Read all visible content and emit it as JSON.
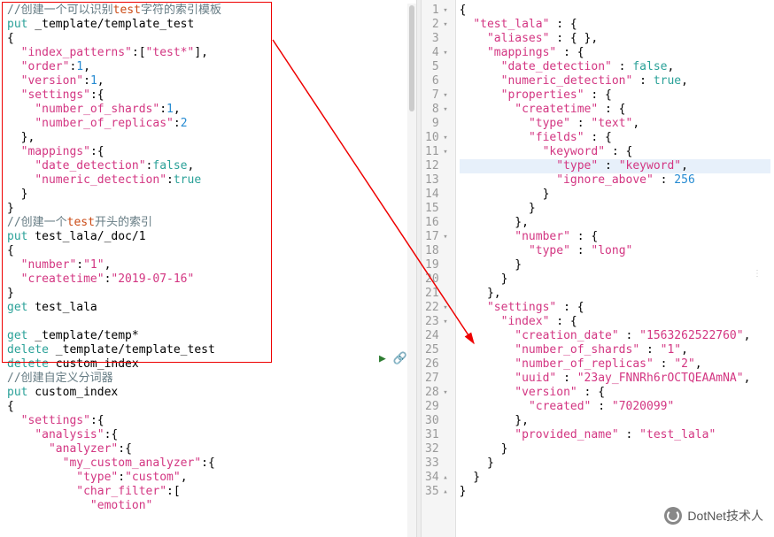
{
  "left": {
    "lines": [
      {
        "segs": [
          {
            "t": "//创建一个可以识别",
            "c": "cmt"
          },
          {
            "t": "test",
            "c": "red"
          },
          {
            "t": "字符的索引模板",
            "c": "cmt"
          }
        ]
      },
      {
        "segs": [
          {
            "t": "put",
            "c": "kw"
          },
          {
            "t": " _template/template_test"
          }
        ]
      },
      {
        "segs": [
          {
            "t": "{"
          }
        ]
      },
      {
        "segs": [
          {
            "t": "  "
          },
          {
            "t": "\"index_patterns\"",
            "c": "str"
          },
          {
            "t": ":["
          },
          {
            "t": "\"test*\"",
            "c": "str"
          },
          {
            "t": "],"
          }
        ]
      },
      {
        "segs": [
          {
            "t": "  "
          },
          {
            "t": "\"order\"",
            "c": "str"
          },
          {
            "t": ":"
          },
          {
            "t": "1",
            "c": "num"
          },
          {
            "t": ","
          }
        ]
      },
      {
        "segs": [
          {
            "t": "  "
          },
          {
            "t": "\"version\"",
            "c": "str"
          },
          {
            "t": ":"
          },
          {
            "t": "1",
            "c": "num"
          },
          {
            "t": ","
          }
        ]
      },
      {
        "segs": [
          {
            "t": "  "
          },
          {
            "t": "\"settings\"",
            "c": "str"
          },
          {
            "t": ":{"
          }
        ]
      },
      {
        "segs": [
          {
            "t": "    "
          },
          {
            "t": "\"number_of_shards\"",
            "c": "str"
          },
          {
            "t": ":"
          },
          {
            "t": "1",
            "c": "num"
          },
          {
            "t": ","
          }
        ]
      },
      {
        "segs": [
          {
            "t": "    "
          },
          {
            "t": "\"number_of_replicas\"",
            "c": "str"
          },
          {
            "t": ":"
          },
          {
            "t": "2",
            "c": "num"
          }
        ]
      },
      {
        "segs": [
          {
            "t": "  },"
          }
        ]
      },
      {
        "segs": [
          {
            "t": "  "
          },
          {
            "t": "\"mappings\"",
            "c": "str"
          },
          {
            "t": ":{"
          }
        ]
      },
      {
        "segs": [
          {
            "t": "    "
          },
          {
            "t": "\"date_detection\"",
            "c": "str"
          },
          {
            "t": ":"
          },
          {
            "t": "false",
            "c": "bool"
          },
          {
            "t": ","
          }
        ]
      },
      {
        "segs": [
          {
            "t": "    "
          },
          {
            "t": "\"numeric_detection\"",
            "c": "str"
          },
          {
            "t": ":"
          },
          {
            "t": "true",
            "c": "bool"
          }
        ]
      },
      {
        "segs": [
          {
            "t": "  }"
          }
        ]
      },
      {
        "segs": [
          {
            "t": "}"
          }
        ]
      },
      {
        "segs": [
          {
            "t": "//创建一个",
            "c": "cmt"
          },
          {
            "t": "test",
            "c": "red"
          },
          {
            "t": "开头的索引",
            "c": "cmt"
          }
        ]
      },
      {
        "segs": [
          {
            "t": "put",
            "c": "kw"
          },
          {
            "t": " test_lala/_doc/1"
          }
        ]
      },
      {
        "segs": [
          {
            "t": "{"
          }
        ]
      },
      {
        "segs": [
          {
            "t": "  "
          },
          {
            "t": "\"number\"",
            "c": "str"
          },
          {
            "t": ":"
          },
          {
            "t": "\"1\"",
            "c": "str"
          },
          {
            "t": ","
          }
        ]
      },
      {
        "segs": [
          {
            "t": "  "
          },
          {
            "t": "\"createtime\"",
            "c": "str"
          },
          {
            "t": ":"
          },
          {
            "t": "\"2019-07-16\"",
            "c": "str"
          }
        ]
      },
      {
        "segs": [
          {
            "t": "}"
          }
        ]
      },
      {
        "segs": [
          {
            "t": "get",
            "c": "kw"
          },
          {
            "t": " test_lala"
          }
        ]
      },
      {
        "segs": [
          {
            "t": ""
          }
        ]
      },
      {
        "segs": [
          {
            "t": "get",
            "c": "kw"
          },
          {
            "t": " _template/temp*"
          }
        ]
      },
      {
        "segs": [
          {
            "t": "delete",
            "c": "kw"
          },
          {
            "t": " _template/template_test"
          }
        ]
      },
      {
        "segs": [
          {
            "t": "delete",
            "c": "kw"
          },
          {
            "t": " custom_index"
          }
        ]
      },
      {
        "segs": [
          {
            "t": "//创建自定义分词器",
            "c": "cmt"
          }
        ]
      },
      {
        "segs": [
          {
            "t": "put",
            "c": "kw"
          },
          {
            "t": " custom_index"
          }
        ]
      },
      {
        "segs": [
          {
            "t": "{"
          }
        ]
      },
      {
        "segs": [
          {
            "t": "  "
          },
          {
            "t": "\"settings\"",
            "c": "str"
          },
          {
            "t": ":{"
          }
        ]
      },
      {
        "segs": [
          {
            "t": "    "
          },
          {
            "t": "\"analysis\"",
            "c": "str"
          },
          {
            "t": ":{"
          }
        ]
      },
      {
        "segs": [
          {
            "t": "      "
          },
          {
            "t": "\"analyzer\"",
            "c": "str"
          },
          {
            "t": ":{"
          }
        ]
      },
      {
        "segs": [
          {
            "t": "        "
          },
          {
            "t": "\"my_custom_analyzer\"",
            "c": "str"
          },
          {
            "t": ":{"
          }
        ]
      },
      {
        "segs": [
          {
            "t": "          "
          },
          {
            "t": "\"type\"",
            "c": "str"
          },
          {
            "t": ":"
          },
          {
            "t": "\"custom\"",
            "c": "str"
          },
          {
            "t": ","
          }
        ]
      },
      {
        "segs": [
          {
            "t": "          "
          },
          {
            "t": "\"char_filter\"",
            "c": "str"
          },
          {
            "t": ":["
          }
        ]
      },
      {
        "segs": [
          {
            "t": "            "
          },
          {
            "t": "\"emotion\"",
            "c": "str"
          }
        ]
      }
    ]
  },
  "right": {
    "lines": [
      {
        "n": 1,
        "fold": "▾",
        "segs": [
          {
            "t": "{"
          }
        ]
      },
      {
        "n": 2,
        "fold": "▾",
        "segs": [
          {
            "t": "  "
          },
          {
            "t": "\"test_lala\"",
            "c": "str"
          },
          {
            "t": " : {"
          }
        ]
      },
      {
        "n": 3,
        "segs": [
          {
            "t": "    "
          },
          {
            "t": "\"aliases\"",
            "c": "str"
          },
          {
            "t": " : { },"
          }
        ]
      },
      {
        "n": 4,
        "fold": "▾",
        "segs": [
          {
            "t": "    "
          },
          {
            "t": "\"mappings\"",
            "c": "str"
          },
          {
            "t": " : {"
          }
        ]
      },
      {
        "n": 5,
        "segs": [
          {
            "t": "      "
          },
          {
            "t": "\"date_detection\"",
            "c": "str"
          },
          {
            "t": " : "
          },
          {
            "t": "false",
            "c": "bool"
          },
          {
            "t": ","
          }
        ]
      },
      {
        "n": 6,
        "segs": [
          {
            "t": "      "
          },
          {
            "t": "\"numeric_detection\"",
            "c": "str"
          },
          {
            "t": " : "
          },
          {
            "t": "true",
            "c": "bool"
          },
          {
            "t": ","
          }
        ]
      },
      {
        "n": 7,
        "fold": "▾",
        "segs": [
          {
            "t": "      "
          },
          {
            "t": "\"properties\"",
            "c": "str"
          },
          {
            "t": " : {"
          }
        ]
      },
      {
        "n": 8,
        "fold": "▾",
        "segs": [
          {
            "t": "        "
          },
          {
            "t": "\"createtime\"",
            "c": "str"
          },
          {
            "t": " : {"
          }
        ]
      },
      {
        "n": 9,
        "segs": [
          {
            "t": "          "
          },
          {
            "t": "\"type\"",
            "c": "str"
          },
          {
            "t": " : "
          },
          {
            "t": "\"text\"",
            "c": "str"
          },
          {
            "t": ","
          }
        ]
      },
      {
        "n": 10,
        "fold": "▾",
        "segs": [
          {
            "t": "          "
          },
          {
            "t": "\"fields\"",
            "c": "str"
          },
          {
            "t": " : {"
          }
        ]
      },
      {
        "n": 11,
        "fold": "▾",
        "segs": [
          {
            "t": "            "
          },
          {
            "t": "\"keyword\"",
            "c": "str"
          },
          {
            "t": " : {"
          }
        ]
      },
      {
        "n": 12,
        "hl": true,
        "segs": [
          {
            "t": "              "
          },
          {
            "t": "\"type\"",
            "c": "str"
          },
          {
            "t": " : "
          },
          {
            "t": "\"keyword\"",
            "c": "str"
          },
          {
            "t": ","
          }
        ]
      },
      {
        "n": 13,
        "segs": [
          {
            "t": "              "
          },
          {
            "t": "\"ignore_above\"",
            "c": "str"
          },
          {
            "t": " : "
          },
          {
            "t": "256",
            "c": "num"
          }
        ]
      },
      {
        "n": 14,
        "segs": [
          {
            "t": "            }"
          }
        ]
      },
      {
        "n": 15,
        "segs": [
          {
            "t": "          }"
          }
        ]
      },
      {
        "n": 16,
        "segs": [
          {
            "t": "        },"
          }
        ]
      },
      {
        "n": 17,
        "fold": "▾",
        "segs": [
          {
            "t": "        "
          },
          {
            "t": "\"number\"",
            "c": "str"
          },
          {
            "t": " : {"
          }
        ]
      },
      {
        "n": 18,
        "segs": [
          {
            "t": "          "
          },
          {
            "t": "\"type\"",
            "c": "str"
          },
          {
            "t": " : "
          },
          {
            "t": "\"long\"",
            "c": "str"
          }
        ]
      },
      {
        "n": 19,
        "segs": [
          {
            "t": "        }"
          }
        ]
      },
      {
        "n": 20,
        "segs": [
          {
            "t": "      }"
          }
        ]
      },
      {
        "n": 21,
        "segs": [
          {
            "t": "    },"
          }
        ]
      },
      {
        "n": 22,
        "fold": "▾",
        "segs": [
          {
            "t": "    "
          },
          {
            "t": "\"settings\"",
            "c": "str"
          },
          {
            "t": " : {"
          }
        ]
      },
      {
        "n": 23,
        "fold": "▾",
        "segs": [
          {
            "t": "      "
          },
          {
            "t": "\"index\"",
            "c": "str"
          },
          {
            "t": " : {"
          }
        ]
      },
      {
        "n": 24,
        "segs": [
          {
            "t": "        "
          },
          {
            "t": "\"creation_date\"",
            "c": "str"
          },
          {
            "t": " : "
          },
          {
            "t": "\"1563262522760\"",
            "c": "str"
          },
          {
            "t": ","
          }
        ]
      },
      {
        "n": 25,
        "segs": [
          {
            "t": "        "
          },
          {
            "t": "\"number_of_shards\"",
            "c": "str"
          },
          {
            "t": " : "
          },
          {
            "t": "\"1\"",
            "c": "str"
          },
          {
            "t": ","
          }
        ]
      },
      {
        "n": 26,
        "segs": [
          {
            "t": "        "
          },
          {
            "t": "\"number_of_replicas\"",
            "c": "str"
          },
          {
            "t": " : "
          },
          {
            "t": "\"2\"",
            "c": "str"
          },
          {
            "t": ","
          }
        ]
      },
      {
        "n": 27,
        "segs": [
          {
            "t": "        "
          },
          {
            "t": "\"uuid\"",
            "c": "str"
          },
          {
            "t": " : "
          },
          {
            "t": "\"23ay_FNNRh6rOCTQEAAmNA\"",
            "c": "str"
          },
          {
            "t": ","
          }
        ]
      },
      {
        "n": 28,
        "fold": "▾",
        "segs": [
          {
            "t": "        "
          },
          {
            "t": "\"version\"",
            "c": "str"
          },
          {
            "t": " : {"
          }
        ]
      },
      {
        "n": 29,
        "segs": [
          {
            "t": "          "
          },
          {
            "t": "\"created\"",
            "c": "str"
          },
          {
            "t": " : "
          },
          {
            "t": "\"7020099\"",
            "c": "str"
          }
        ]
      },
      {
        "n": 30,
        "segs": [
          {
            "t": "        },"
          }
        ]
      },
      {
        "n": 31,
        "segs": [
          {
            "t": "        "
          },
          {
            "t": "\"provided_name\"",
            "c": "str"
          },
          {
            "t": " : "
          },
          {
            "t": "\"test_lala\"",
            "c": "str"
          }
        ]
      },
      {
        "n": 32,
        "segs": [
          {
            "t": "      }"
          }
        ]
      },
      {
        "n": 33,
        "segs": [
          {
            "t": "    }"
          }
        ]
      },
      {
        "n": 34,
        "fold": "▴",
        "segs": [
          {
            "t": "  }"
          }
        ]
      },
      {
        "n": 35,
        "fold": "▴",
        "segs": [
          {
            "t": "}"
          }
        ]
      }
    ]
  },
  "watermark": "DotNet技术人",
  "icons": {
    "play": "▶",
    "link": "🔗"
  }
}
